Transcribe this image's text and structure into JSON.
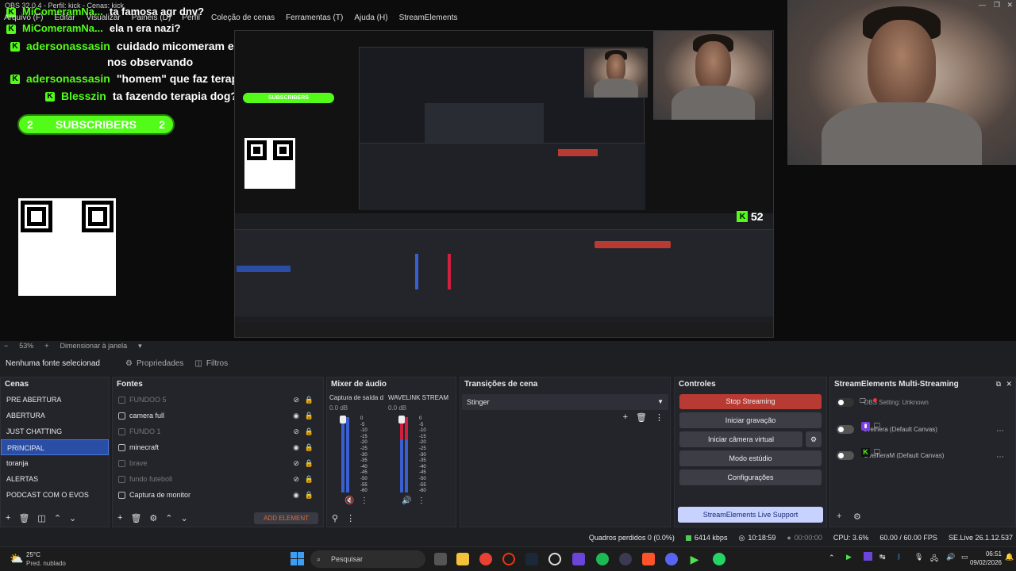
{
  "window": {
    "title": "OBS 32.0.4 - Perfil: kick - Cenas: kick",
    "menu": [
      "Arquivo (F)",
      "Editar",
      "Visualizar",
      "Painéis (D)",
      "Perfil",
      "Coleção de cenas",
      "Ferramentas (T)",
      "Ajuda (H)",
      "StreamElements"
    ]
  },
  "preview": {
    "chat": [
      {
        "name": "MiComeramNa...",
        "msg": "ta famosa agr dnv?"
      },
      {
        "name": "MiComeramNa...",
        "msg": "ela n era nazi?"
      },
      {
        "name": "adersonassasin",
        "msg": "cuidado micomeram eles estão"
      },
      {
        "name": "",
        "msg": "nos observando"
      },
      {
        "name": "adersonassasin",
        "msg": "\"homem\" que faz terapia"
      },
      {
        "name": "Blesszin",
        "msg": "ta fazendo terapia dog?"
      }
    ],
    "subscribers": {
      "left": "2",
      "label": "SUBSCRIBERS",
      "right": "2"
    },
    "kick_count": "52",
    "kick_letter": "K"
  },
  "zoom": {
    "level": "53%",
    "mode": "Dimensionar à janela"
  },
  "context": {
    "no_source": "Nenhuma fonte selecionad",
    "properties": "Propriedades",
    "filters": "Filtros"
  },
  "scenes": {
    "title": "Cenas",
    "items": [
      "PRE ABERTURA",
      "ABERTURA",
      "JUST CHATTING",
      "PRINCIPAL",
      "toranja",
      "ALERTAS",
      "PODCAST COM O EVOS"
    ],
    "selected": 3
  },
  "sources": {
    "title": "Fontes",
    "items": [
      {
        "label": "FUNDOO 5",
        "visible": false
      },
      {
        "label": "camera full",
        "visible": true
      },
      {
        "label": "FUNDO 1",
        "visible": false
      },
      {
        "label": "minecraft",
        "visible": true
      },
      {
        "label": "brave",
        "visible": false
      },
      {
        "label": "fundo futeboll",
        "visible": false
      },
      {
        "label": "Captura de monitor",
        "visible": true
      }
    ],
    "add_element": "ADD ELEMENT"
  },
  "audio": {
    "title": "Mixer de áudio",
    "channels": [
      {
        "name": "Captura de saída d",
        "db": "0.0 dB"
      },
      {
        "name": "WAVELINK STREAM",
        "db": "0.0 dB"
      }
    ],
    "scale": [
      "0",
      "-5",
      "-10",
      "-15",
      "-20",
      "-25",
      "-30",
      "-35",
      "-40",
      "-45",
      "-50",
      "-55",
      "-60"
    ]
  },
  "transitions": {
    "title": "Transições de cena",
    "selected": "Stinger"
  },
  "controls": {
    "title": "Controles",
    "buttons": [
      "Stop Streaming",
      "Iniciar gravação",
      "Iniciar câmera virtual",
      "Modo estúdio",
      "Configurações"
    ],
    "support": "StreamElements Live Support"
  },
  "multistream": {
    "title": "StreamElements Multi-Streaming",
    "rows": [
      {
        "label": "OBS Setting: Unknown"
      },
      {
        "label": "ovelhera (Default Canvas)"
      },
      {
        "label": "OvelheraM (Default Canvas)"
      }
    ]
  },
  "status": {
    "dropped": "Quadros perdidos 0 (0.0%)",
    "kbps": "6414 kbps",
    "live_time": "10:18:59",
    "rec_time": "00:00:00",
    "cpu": "CPU: 3.6%",
    "fps": "60.00 / 60.00 FPS",
    "se_version": "SE.Live 26.1.12.537"
  },
  "taskbar": {
    "weather_temp": "25°C",
    "weather_desc": "Pred. nublado",
    "search": "Pesquisar",
    "time": "06:51",
    "date": "09/02/2026"
  },
  "colors": {
    "kick_green": "#53fc18",
    "stop_red": "#b83b33",
    "selected_blue": "#2a4ea6"
  }
}
